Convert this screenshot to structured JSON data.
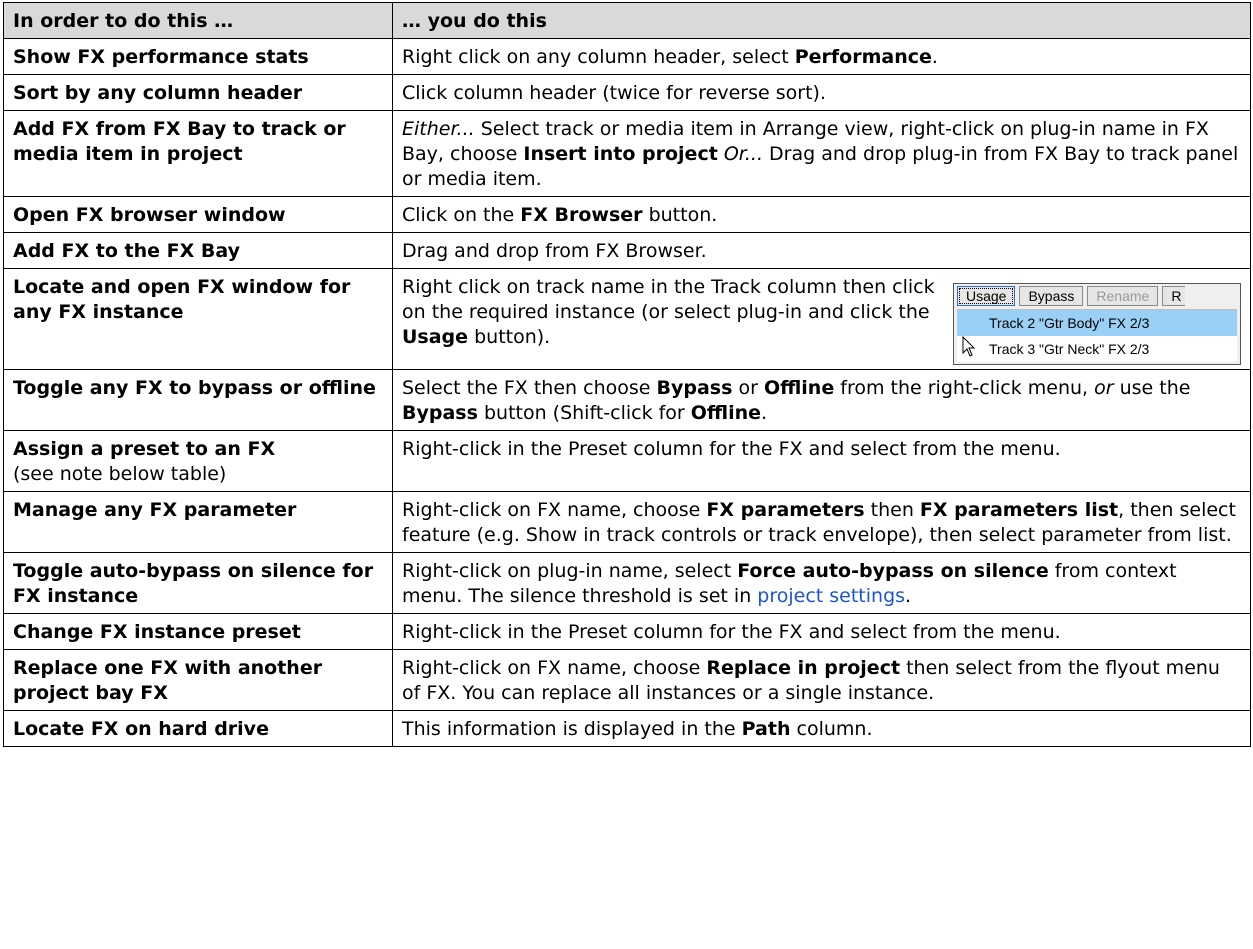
{
  "header": {
    "col1": "In order to do this …",
    "col2": "… you do this"
  },
  "rows": [
    {
      "action": "Show FX performance stats",
      "p1": "Right click on any column header, select ",
      "b1": "Performance",
      "p2": "."
    },
    {
      "action": "Sort by any column header",
      "p1": "Click column header (twice for reverse sort)."
    },
    {
      "action": "Add FX from FX Bay to track or media item in project",
      "i1": "Either...",
      "p1": " Select track or media item in Arrange view, right-click on plug-in name in FX Bay, choose ",
      "b1": "Insert into project",
      "p2": " ",
      "i2": "Or...",
      "p3": " Drag and drop plug-in from FX Bay to track panel or media item."
    },
    {
      "action": "Open FX browser window",
      "p1": "Click on the ",
      "b1": "FX Browser",
      "p2": " button."
    },
    {
      "action": "Add FX to the FX Bay",
      "p1": "Drag and drop from FX Browser."
    },
    {
      "action": "Locate and open FX window for any FX instance",
      "p1": "Right click on track name in the Track column then click on the required instance (or select plug-in and click the ",
      "b1": "Usage",
      "p2": " button)."
    },
    {
      "action": "Toggle any FX to bypass or offline",
      "p1": "Select the FX then choose ",
      "b1": "Bypass",
      "p2": " or ",
      "b2": "Offline",
      "p3": " from the right-click menu, ",
      "i1": "or",
      "p4": " use the ",
      "b3": "Bypass",
      "p5": " button (Shift-click for ",
      "b4": "Offline",
      "p6": "."
    },
    {
      "action": "Assign a preset to an FX",
      "note": "(see note below table)",
      "p1": "Right-click in the Preset column for the FX and select from the menu."
    },
    {
      "action": "Manage any FX parameter",
      "p1": "Right-click on FX name, choose ",
      "b1": "FX parameters",
      "p2": " then ",
      "b2": "FX parameters list",
      "p3": ", then select feature (e.g. Show in track controls or track envelope), then select parameter from list."
    },
    {
      "action": "Toggle auto-bypass on silence for FX instance",
      "p1": "Right-click on plug-in name, select ",
      "b1": "Force auto-bypass on silence",
      "p2": " from context menu. The silence threshold is set in ",
      "link": "project settings",
      "p3": "."
    },
    {
      "action": "Change FX instance preset",
      "p1": "Right-click in the Preset column for the FX and select from the menu."
    },
    {
      "action": "Replace one FX with another project bay FX",
      "p1": "Right-click on FX name, choose ",
      "b1": "Replace in project",
      "p2": " then select from the flyout menu of FX. You can replace all instances or a single instance."
    },
    {
      "action": "Locate FX on hard drive",
      "p1": "This information is displayed in the ",
      "b1": "Path",
      "p2": " column."
    }
  ],
  "usage_panel": {
    "buttons": [
      "Usage",
      "Bypass",
      "Rename",
      "R"
    ],
    "items": [
      "Track 2 \"Gtr Body\"  FX 2/3",
      "Track 3 \"Gtr Neck\"  FX 2/3"
    ]
  },
  "colors": {
    "header_bg": "#d9d9d9",
    "link": "#1a55d6",
    "menu_highlight": "#9ad0f5"
  }
}
